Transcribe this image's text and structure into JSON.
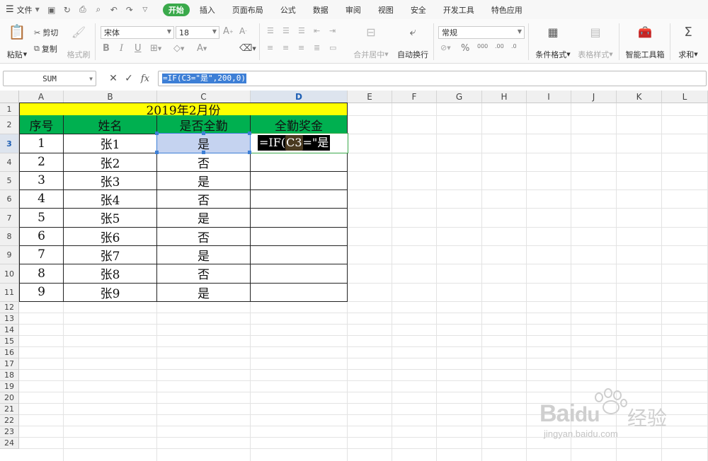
{
  "menubar": {
    "file": "文件",
    "tabs": [
      "开始",
      "插入",
      "页面布局",
      "公式",
      "数据",
      "审阅",
      "视图",
      "安全",
      "开发工具",
      "特色应用"
    ],
    "active_tab": "开始"
  },
  "ribbon": {
    "paste": "粘贴",
    "cut": "剪切",
    "copy": "复制",
    "format_painter": "格式刷",
    "font_name": "宋体",
    "font_size": "18",
    "merge_center": "合并居中",
    "wrap_text": "自动换行",
    "number_format": "常规",
    "cond_format": "条件格式",
    "table_style": "表格样式",
    "smart_toolbox": "智能工具箱",
    "sum": "求和"
  },
  "formula_bar": {
    "name_box": "SUM",
    "fx": "fx",
    "formula": "=IF(C3=\"是\",200,0)"
  },
  "columns": [
    "A",
    "B",
    "C",
    "D",
    "E",
    "F",
    "G",
    "H",
    "I",
    "J",
    "K",
    "L"
  ],
  "rows": [
    "1",
    "2",
    "3",
    "4",
    "5",
    "6",
    "7",
    "8",
    "9",
    "10",
    "11",
    "12",
    "13",
    "14",
    "15",
    "16",
    "17",
    "18",
    "19",
    "20",
    "21",
    "22",
    "23",
    "24"
  ],
  "sheet": {
    "title": "2019年2月份",
    "headers": [
      "序号",
      "姓名",
      "是否全勤",
      "全勤奖金"
    ],
    "data": [
      [
        "1",
        "张1",
        "是"
      ],
      [
        "2",
        "张2",
        "否"
      ],
      [
        "3",
        "张3",
        "是"
      ],
      [
        "4",
        "张4",
        "否"
      ],
      [
        "5",
        "张5",
        "是"
      ],
      [
        "6",
        "张6",
        "否"
      ],
      [
        "7",
        "张7",
        "是"
      ],
      [
        "8",
        "张8",
        "否"
      ],
      [
        "9",
        "张9",
        "是"
      ]
    ],
    "editing": {
      "prefix": "=IF(",
      "ref": "C3",
      "suffix": "=\"是"
    }
  },
  "colors": {
    "title_fill": "#ffff00",
    "header_fill": "#00b050",
    "ref_highlight": "#c5d3f0",
    "active_tab": "#3aa94b"
  },
  "watermark": {
    "brand": "Bai",
    "brand2": "du",
    "cn": "经验",
    "url": "jingyan.baidu.com"
  }
}
